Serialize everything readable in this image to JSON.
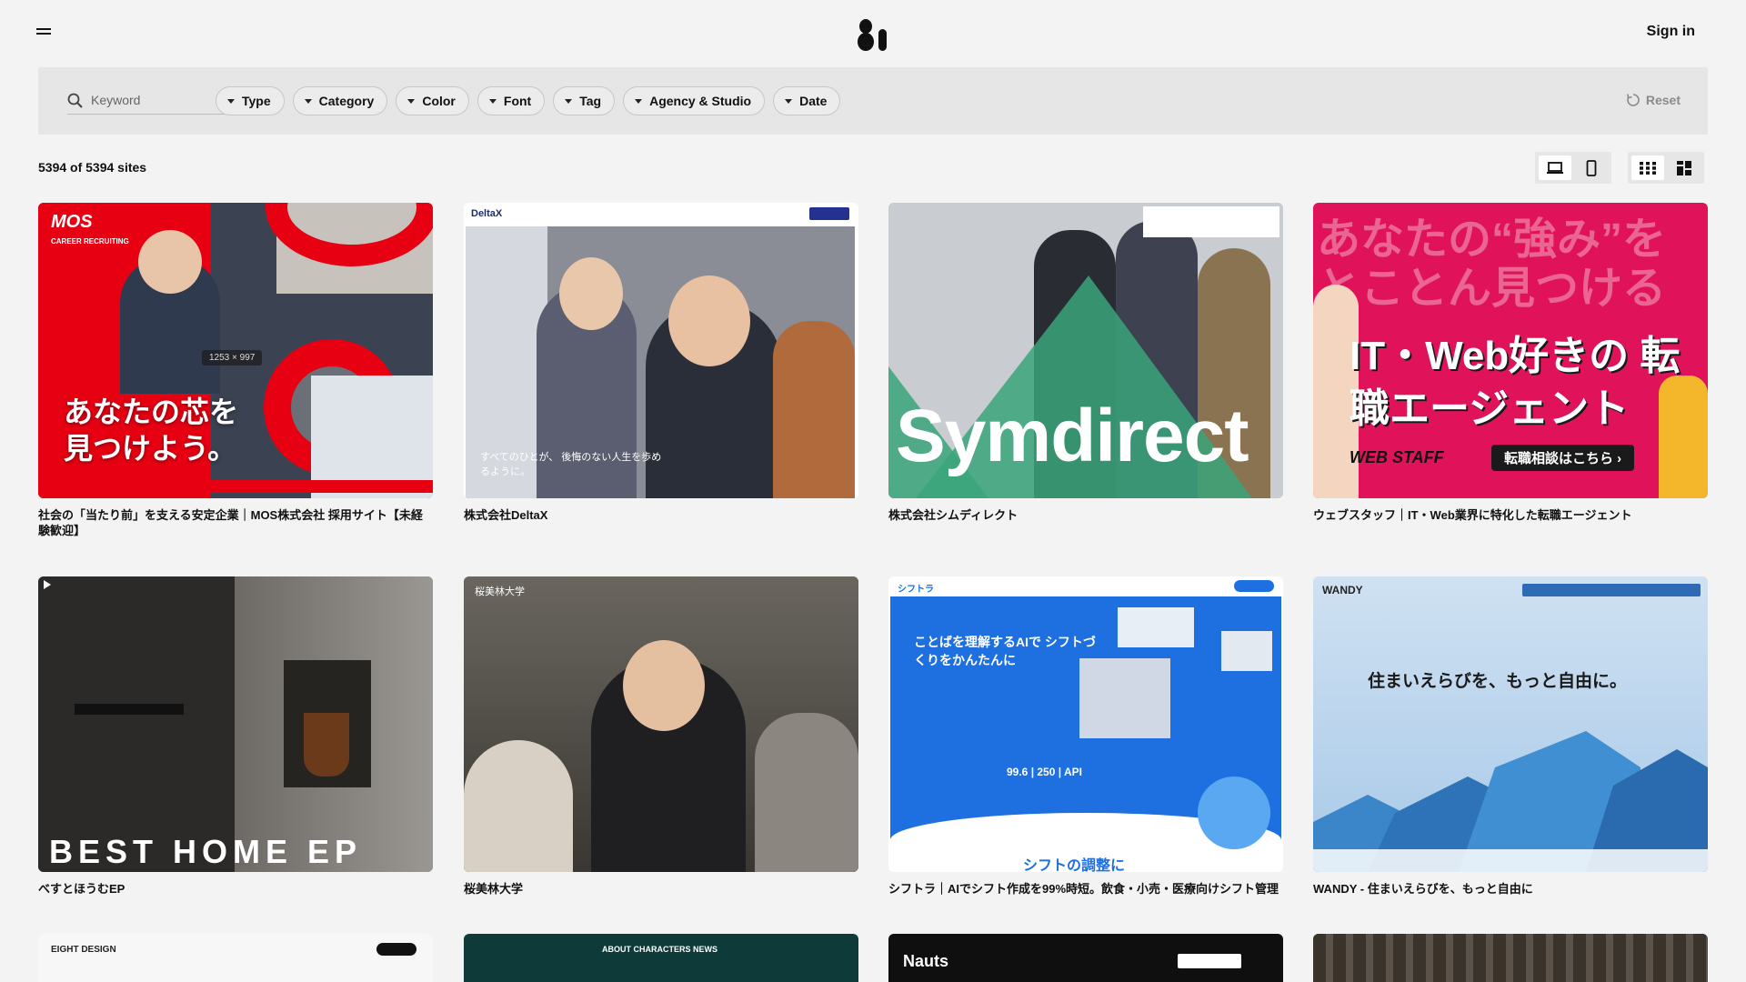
{
  "header": {
    "sign_in": "Sign in"
  },
  "filters": {
    "search_placeholder": "Keyword",
    "chips": [
      "Type",
      "Category",
      "Color",
      "Font",
      "Tag",
      "Agency & Studio",
      "Date"
    ],
    "reset": "Reset"
  },
  "results": {
    "count_text": "5394 of 5394 sites"
  },
  "cards": [
    {
      "title": "社会の「当たり前」を支える安定企業｜MOS株式会社 採用サイト【未経験歓迎】",
      "logo": "MOS",
      "logo_sub": "CAREER RECRUITING",
      "headline": "あなたの芯を 見つけよう。",
      "size_badge": "1253 × 997"
    },
    {
      "title": "株式会社DeltaX",
      "logo": "DeltaX",
      "headline": "すべてのひとが、 後悔のない人生を歩めるように。"
    },
    {
      "title": "株式会社シムディレクト",
      "headline": "Symdirect"
    },
    {
      "title": "ウェブスタッフ｜IT・Web業界に特化した転職エージェント",
      "headline_top": "あなたの“強み”を とことん見つける",
      "headline": "IT・Web好きの 転職エージェント",
      "brand": "WEB STAFF",
      "cta": "転職相談はこちら ›"
    },
    {
      "title": "べすとほうむEP",
      "headline": "BEST HOME EP"
    },
    {
      "title": "桜美林大学",
      "logo": "桜美林大学"
    },
    {
      "title": "シフトラ｜AIでシフト作成を99%時短。飲食・小売・医療向けシフト管理",
      "logo": "シフトラ",
      "headline": "ことばを理解するAIで シフトづくりをかんたんに",
      "stats": "99.6 | 250 | API",
      "footer": "シフトの調整に"
    },
    {
      "title": "WANDY - 住まいえらびを、もっと自由に",
      "logo": "WANDY",
      "headline": "住まいえらびを、もっと自由に。"
    },
    {
      "logo": "EIGHT DESIGN"
    },
    {
      "nav": "ABOUT  CHARACTERS  NEWS"
    },
    {
      "logo": "Nauts"
    },
    {
      "logo": ""
    }
  ],
  "colors": {
    "page_bg": "#f3f3f3",
    "filter_bg": "#e6e6e6",
    "mos_red": "#e60012",
    "webstaff_pink": "#e0135a",
    "symdirect_green": "#3aa57a",
    "shiftra_blue": "#1e6fe0",
    "wandy_blue": "#3a86c8"
  }
}
